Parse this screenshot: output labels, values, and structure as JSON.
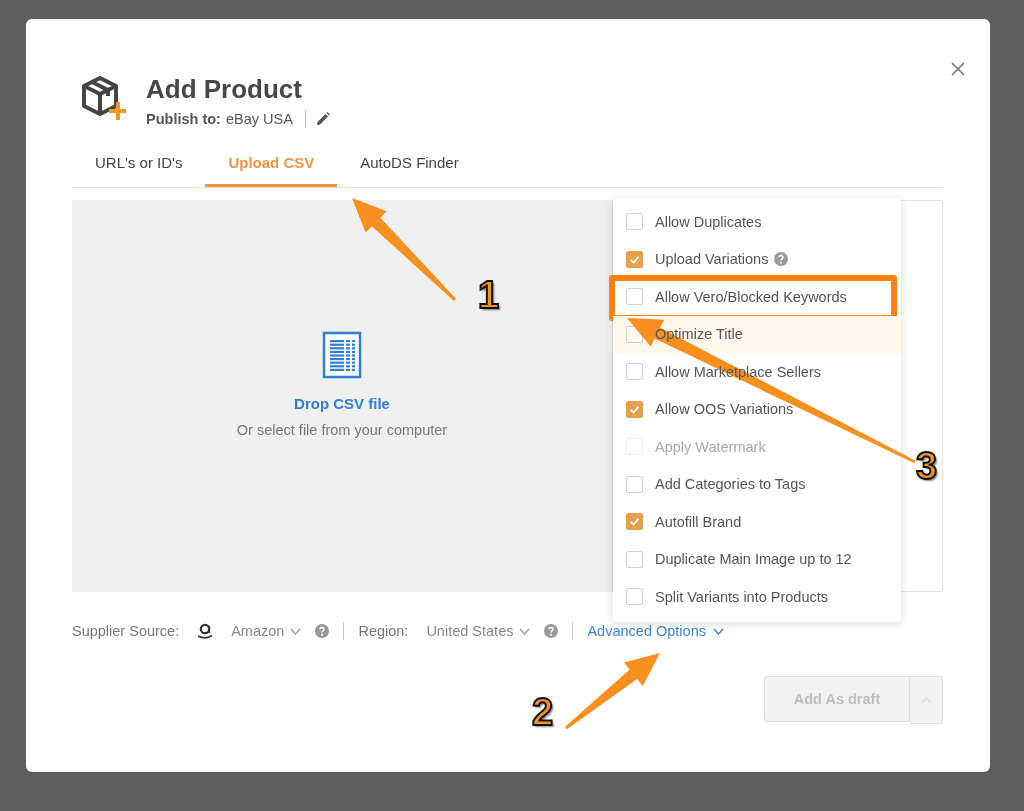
{
  "dialog": {
    "title": "Add Product",
    "publish_label": "Publish to:",
    "publish_target": "eBay USA"
  },
  "tabs": [
    {
      "label": "URL's or ID's",
      "selected": false
    },
    {
      "label": "Upload CSV",
      "selected": true
    },
    {
      "label": "AutoDS Finder",
      "selected": false
    }
  ],
  "dropzone": {
    "title": "Drop CSV file",
    "subtitle": "Or select file from your computer"
  },
  "advanced_options": [
    {
      "label": "Allow Duplicates",
      "checked": false,
      "disabled": false,
      "hovered": false,
      "help": false,
      "highlighted": false
    },
    {
      "label": "Upload Variations",
      "checked": true,
      "disabled": false,
      "hovered": false,
      "help": true,
      "highlighted": false
    },
    {
      "label": "Allow Vero/Blocked Keywords",
      "checked": false,
      "disabled": false,
      "hovered": false,
      "help": false,
      "highlighted": true
    },
    {
      "label": "Optimize Title",
      "checked": false,
      "disabled": false,
      "hovered": true,
      "help": false,
      "highlighted": false
    },
    {
      "label": "Allow Marketplace Sellers",
      "checked": false,
      "disabled": false,
      "hovered": false,
      "help": false,
      "highlighted": false
    },
    {
      "label": "Allow OOS Variations",
      "checked": true,
      "disabled": false,
      "hovered": false,
      "help": false,
      "highlighted": false
    },
    {
      "label": "Apply Watermark",
      "checked": false,
      "disabled": true,
      "hovered": false,
      "help": false,
      "highlighted": false
    },
    {
      "label": "Add Categories to Tags",
      "checked": false,
      "disabled": false,
      "hovered": false,
      "help": false,
      "highlighted": false
    },
    {
      "label": "Autofill Brand",
      "checked": true,
      "disabled": false,
      "hovered": false,
      "help": false,
      "highlighted": false
    },
    {
      "label": "Duplicate Main Image up to 12",
      "checked": false,
      "disabled": false,
      "hovered": false,
      "help": false,
      "highlighted": false
    },
    {
      "label": "Split Variants into Products",
      "checked": false,
      "disabled": false,
      "hovered": false,
      "help": false,
      "highlighted": false
    }
  ],
  "footer": {
    "supplier_label": "Supplier Source:",
    "supplier_value": "Amazon",
    "region_label": "Region:",
    "region_value": "United States",
    "advanced_link": "Advanced Options"
  },
  "buttons": [
    {
      "label": "Add As draft",
      "disabled": true
    }
  ],
  "callouts": [
    {
      "number": "1"
    },
    {
      "number": "2"
    },
    {
      "number": "3"
    }
  ]
}
